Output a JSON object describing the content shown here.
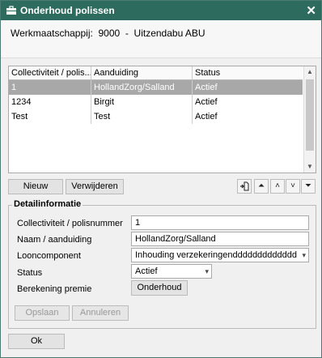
{
  "window": {
    "title": "Onderhoud polissen",
    "close_label": "✕"
  },
  "company": {
    "label": "Werkmaatschappij:",
    "code": "9000",
    "separator": "-",
    "name": "Uitzendabu ABU"
  },
  "grid": {
    "columns": [
      "Collectiviteit / polis...",
      "Aanduiding",
      "Status"
    ],
    "rows": [
      {
        "c1": "1",
        "c2": "HollandZorg/Salland",
        "c3": "Actief"
      },
      {
        "c1": "1234",
        "c2": "Birgit",
        "c3": "Actief"
      },
      {
        "c1": "Test",
        "c2": "Test",
        "c3": "Actief"
      }
    ]
  },
  "list_buttons": {
    "new": "Nieuw",
    "delete": "Verwijderen"
  },
  "detail": {
    "legend": "Detailinformatie",
    "labels": {
      "collectivity": "Collectiviteit / polisnummer",
      "name": "Naam / aanduiding",
      "wage_component": "Looncomponent",
      "status": "Status",
      "premium": "Berekening premie"
    },
    "values": {
      "collectivity": "1",
      "name": "HollandZorg/Salland",
      "wage_component": "Inhouding verzekeringenddddddddddddd",
      "status": "Actief"
    },
    "premium_button": "Onderhoud",
    "save": "Opslaan",
    "cancel": "Annuleren"
  },
  "ok": "Ok"
}
